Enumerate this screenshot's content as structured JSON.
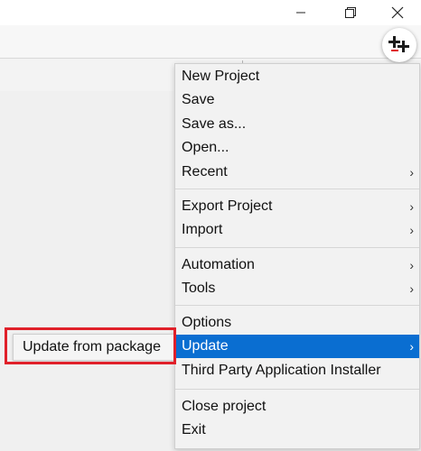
{
  "window": {
    "controls": [
      "minimize-icon",
      "restore-icon",
      "close-icon"
    ]
  },
  "app_button": {
    "icon": "app-logo-icon"
  },
  "menu": {
    "groups": [
      [
        {
          "label": "New Project",
          "submenu": false
        },
        {
          "label": "Save",
          "submenu": false
        },
        {
          "label": "Save as...",
          "submenu": false
        },
        {
          "label": "Open...",
          "submenu": false
        },
        {
          "label": "Recent",
          "submenu": true
        }
      ],
      [
        {
          "label": "Export Project",
          "submenu": true
        },
        {
          "label": "Import",
          "submenu": true
        }
      ],
      [
        {
          "label": "Automation",
          "submenu": true
        },
        {
          "label": "Tools",
          "submenu": true
        }
      ],
      [
        {
          "label": "Options",
          "submenu": false
        },
        {
          "label": "Update",
          "submenu": true,
          "highlighted": true
        },
        {
          "label": "Third Party Application Installer",
          "submenu": false
        }
      ],
      [
        {
          "label": "Close project",
          "submenu": false
        },
        {
          "label": "Exit",
          "submenu": false
        }
      ]
    ],
    "chevron": "›"
  },
  "submenu": {
    "items": [
      {
        "label": "Update from package"
      }
    ]
  },
  "colors": {
    "highlight": "#0a6ed1",
    "callout": "#e0202a"
  }
}
